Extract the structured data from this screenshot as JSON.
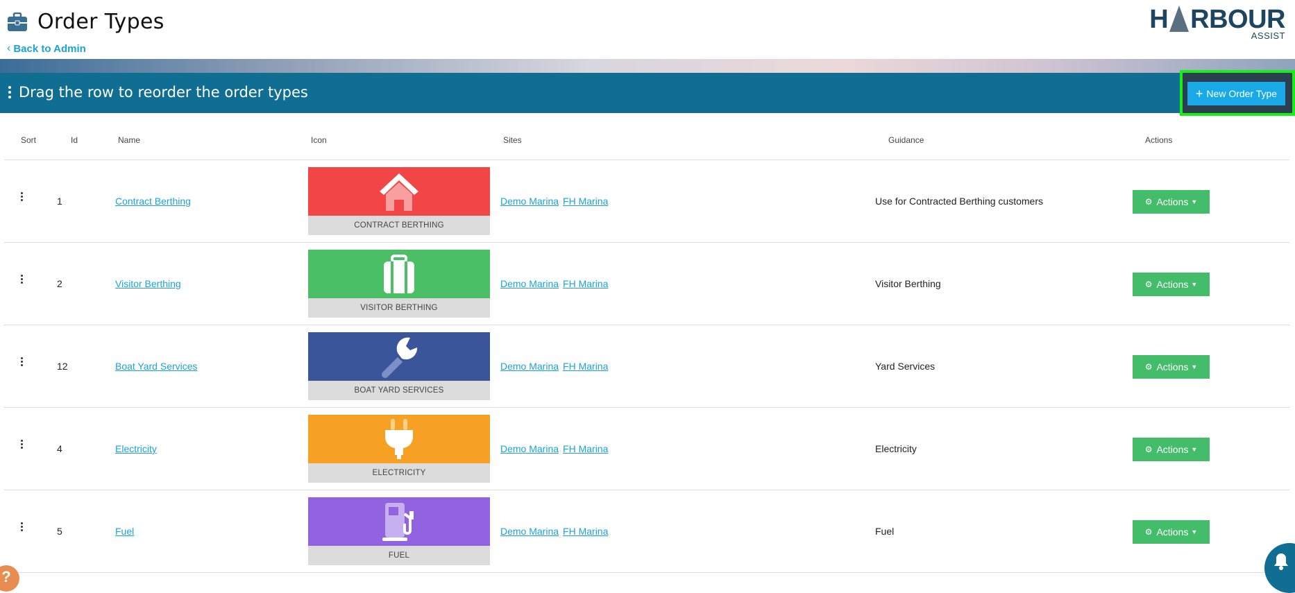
{
  "header": {
    "title": "Order Types",
    "back_label": "Back to Admin",
    "logo_main_left": "H",
    "logo_main_right": "RBOUR",
    "logo_sub": "ASSIST"
  },
  "banner": {
    "text": "Drag the row to reorder the order types",
    "new_button_label": "New Order Type"
  },
  "table": {
    "columns": {
      "sort": "Sort",
      "id": "Id",
      "name": "Name",
      "icon": "Icon",
      "sites": "Sites",
      "guidance": "Guidance",
      "actions": "Actions"
    },
    "rows": [
      {
        "id": "1",
        "name": "Contract Berthing",
        "icon_label": "CONTRACT BERTHING",
        "icon_name": "house-icon",
        "icon_color": "#f24545",
        "site1": "Demo Marina",
        "site2": "FH Marina",
        "guidance": "Use for Contracted Berthing customers",
        "actions_label": "Actions"
      },
      {
        "id": "2",
        "name": "Visitor Berthing",
        "icon_label": "VISITOR BERTHING",
        "icon_name": "suitcase-icon",
        "icon_color": "#4bbf66",
        "site1": "Demo Marina",
        "site2": "FH Marina",
        "guidance": "Visitor Berthing",
        "actions_label": "Actions"
      },
      {
        "id": "12",
        "name": "Boat Yard Services",
        "icon_label": "BOAT YARD SERVICES",
        "icon_name": "wrench-icon",
        "icon_color": "#3b559b",
        "site1": "Demo Marina",
        "site2": "FH Marina",
        "guidance": "Yard Services",
        "actions_label": "Actions"
      },
      {
        "id": "4",
        "name": "Electricity",
        "icon_label": "ELECTRICITY",
        "icon_name": "plug-icon",
        "icon_color": "#f6a124",
        "site1": "Demo Marina",
        "site2": "FH Marina",
        "guidance": "Electricity",
        "actions_label": "Actions"
      },
      {
        "id": "5",
        "name": "Fuel",
        "icon_label": "FUEL",
        "icon_name": "fuel-pump-icon",
        "icon_color": "#9163e1",
        "site1": "Demo Marina",
        "site2": "FH Marina",
        "guidance": "Fuel",
        "actions_label": "Actions"
      }
    ]
  },
  "help_label": "?",
  "colors": {
    "banner": "#0f6e92",
    "link": "#1aa3d9",
    "actions_button": "#44bd6a",
    "new_button": "#18a9e6",
    "highlight_frame": "#19ee19"
  }
}
